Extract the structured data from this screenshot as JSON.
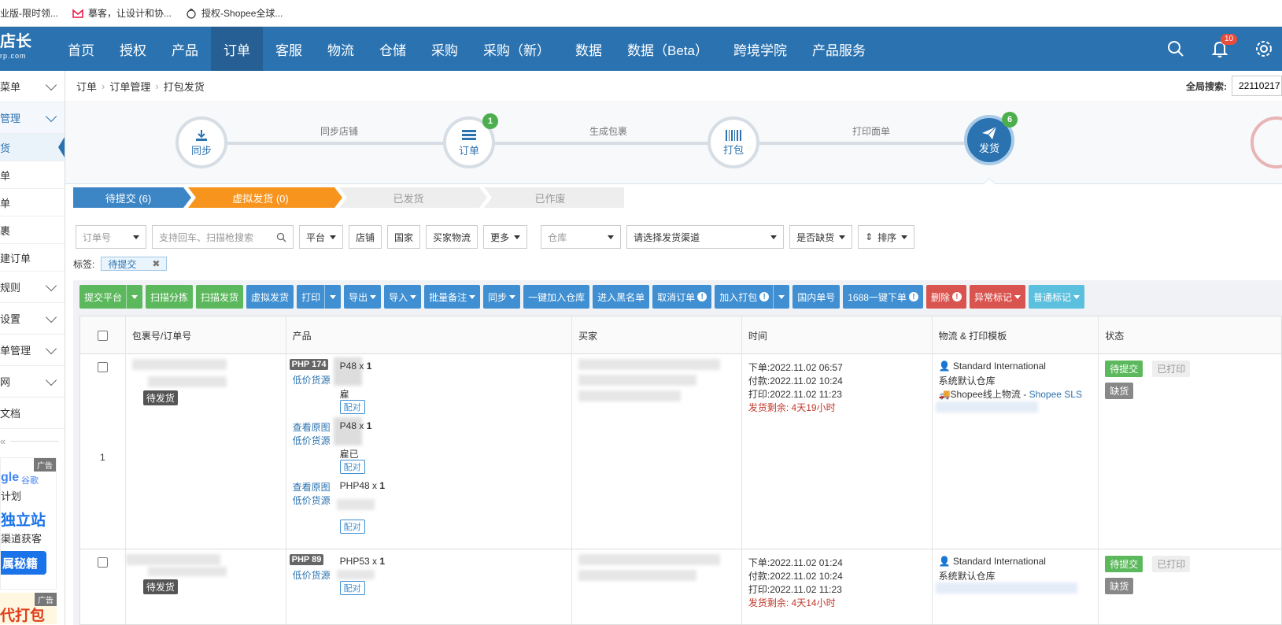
{
  "bookmarks": [
    {
      "label": "业版-限时领..."
    },
    {
      "label": "摹客，让设计和协..."
    },
    {
      "label": "授权-Shopee全球..."
    }
  ],
  "logo": {
    "text": "店长",
    "sub": "rp.com"
  },
  "nav": [
    "首页",
    "授权",
    "产品",
    "订单",
    "客服",
    "物流",
    "仓储",
    "采购",
    "采购（新）",
    "数据",
    "数据（Beta）",
    "跨境学院",
    "产品服务"
  ],
  "nav_active_index": 3,
  "notifications": {
    "count": "10"
  },
  "sidebar": {
    "items_top": [
      {
        "label": "菜单"
      },
      {
        "label": "管理"
      }
    ],
    "subitems": [
      "货",
      "单",
      "单",
      "裹",
      "建订单"
    ],
    "items_bottom": [
      "规则",
      "设置",
      "单管理",
      "网",
      "文档"
    ],
    "collapse": "«",
    "ad1": {
      "tag": "广告",
      "brand": "gle",
      "brand2": "谷歌",
      "l1": "计划",
      "l2": "独立站",
      "l3": "渠道获客",
      "btn": "属秘籍"
    },
    "ad2": {
      "tag": "广告",
      "l1": "代打包"
    }
  },
  "breadcrumb": [
    "订单",
    "订单管理",
    "打包发货"
  ],
  "global_search": {
    "label": "全局搜索:",
    "value": "22110217"
  },
  "process": {
    "steps": [
      {
        "label": "同步",
        "badge": ""
      },
      {
        "label": "订单",
        "badge": "1"
      },
      {
        "label": "打包",
        "badge": ""
      },
      {
        "label": "发货",
        "badge": "6"
      }
    ],
    "links": [
      "同步店铺",
      "生成包裹",
      "打印面单"
    ]
  },
  "subtabs": [
    "待提交 (6)",
    "虚拟发货 (0)",
    "已发货",
    "已作废"
  ],
  "filters": {
    "order_no": "订单号",
    "search_placeholder": "支持回车、扫描枪搜索",
    "platform": "平台",
    "shop": "店铺",
    "country": "国家",
    "buyer_logistics": "买家物流",
    "more": "更多",
    "warehouse": "仓库",
    "channel": "请选择发货渠道",
    "out_of_stock": "是否缺货",
    "sort": "排序"
  },
  "tags": {
    "label": "标签:",
    "chip": "待提交"
  },
  "actions": {
    "submit": "提交平台",
    "scan_sort": "扫描分拣",
    "scan_ship": "扫描发货",
    "virtual_ship": "虚拟发货",
    "print": "打印",
    "export": "导出",
    "import": "导入",
    "batch_note": "批量备注",
    "sync": "同步",
    "add_warehouse": "一键加入仓库",
    "blacklist": "进入黑名单",
    "cancel_order": "取消订单",
    "add_pack": "加入打包",
    "domestic_no": "国内单号",
    "order_1688": "1688一键下单",
    "delete": "删除",
    "abnormal": "异常标记",
    "normal": "普通标记"
  },
  "table": {
    "headers": [
      "包裹号/订单号",
      "产品",
      "买家",
      "时间",
      "物流 & 打印模板",
      "状态"
    ],
    "rows": [
      {
        "index": "1",
        "pack_status": "待发货",
        "php_tag": "PHP 174",
        "products": [
          {
            "links": [
              "低价货源"
            ],
            "qty_prefix": "P48 x ",
            "qty": "1",
            "name": "雇",
            "pair": "配对"
          },
          {
            "links": [
              "查看原图",
              "低价货源"
            ],
            "qty_prefix": "P48 x ",
            "qty": "1",
            "name": "雇已",
            "pair": "配对"
          },
          {
            "links": [
              "查看原图",
              "低价货源"
            ],
            "qty_prefix": "PHP48 x ",
            "qty": "1",
            "name": "",
            "pair": "配对"
          }
        ],
        "times": [
          "下单:2022.11.02 06:57",
          "付款:2022.11.02 10:24",
          "打印:2022.11.02 11:23"
        ],
        "time_left": "发货剩余: 4天19小时",
        "logistics": {
          "service": "Standard International",
          "warehouse": "系统默认仓库",
          "carrier": "Shopee线上物流 - ",
          "carrier_link": "Shopee SLS"
        },
        "statuses": [
          "待提交",
          "已打印",
          "缺货"
        ]
      },
      {
        "index": "",
        "pack_status": "待发货",
        "php_tag": "PHP 89",
        "products": [
          {
            "links": [
              "低价货源"
            ],
            "qty_prefix": "PHP53 x ",
            "qty": "1",
            "name": "",
            "pair": "配对"
          }
        ],
        "times": [
          "下单:2022.11.02 01:24",
          "付款:2022.11.02 10:24",
          "打印:2022.11.02 11:23"
        ],
        "time_left": "发货剩余: 4天14小时",
        "logistics": {
          "service": "Standard International",
          "warehouse": "系统默认仓库",
          "carrier": "",
          "carrier_link": ""
        },
        "statuses": [
          "待提交",
          "已打印",
          "缺货"
        ]
      }
    ]
  },
  "colors": {
    "nav": "#2b73b0",
    "active_tab": "#f7941d",
    "green": "#5cb85c",
    "blue": "#3f8fd2",
    "red": "#d9534f"
  }
}
